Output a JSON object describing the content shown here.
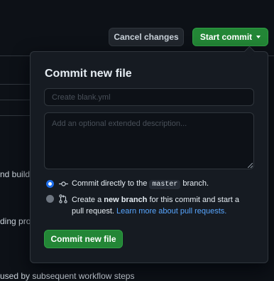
{
  "header": {
    "cancel_label": "Cancel changes",
    "start_commit_label": "Start commit"
  },
  "background": {
    "fragment_1": "nd build",
    "fragment_2": "ding pro",
    "fragment_3": "used by subsequent workflow steps"
  },
  "commit_popover": {
    "title": "Commit new file",
    "filename_placeholder": "Create blank.yml",
    "description_placeholder": "Add an optional extended description...",
    "option_direct": {
      "prefix": "Commit directly to the",
      "branch": "master",
      "suffix": "branch.",
      "selected": true
    },
    "option_new_branch": {
      "prefix": "Create a",
      "bold": "new branch",
      "suffix": "for this commit and start a pull request.",
      "link": "Learn more about pull requests.",
      "selected": false
    },
    "submit_label": "Commit new file"
  },
  "colors": {
    "accent_green": "#238636",
    "link_blue": "#58a6ff",
    "radio_blue": "#1f6feb"
  },
  "icons": {
    "option_direct": "git-commit-icon",
    "option_new_branch": "git-pull-request-icon",
    "start_commit_caret": "triangle-down-icon"
  }
}
